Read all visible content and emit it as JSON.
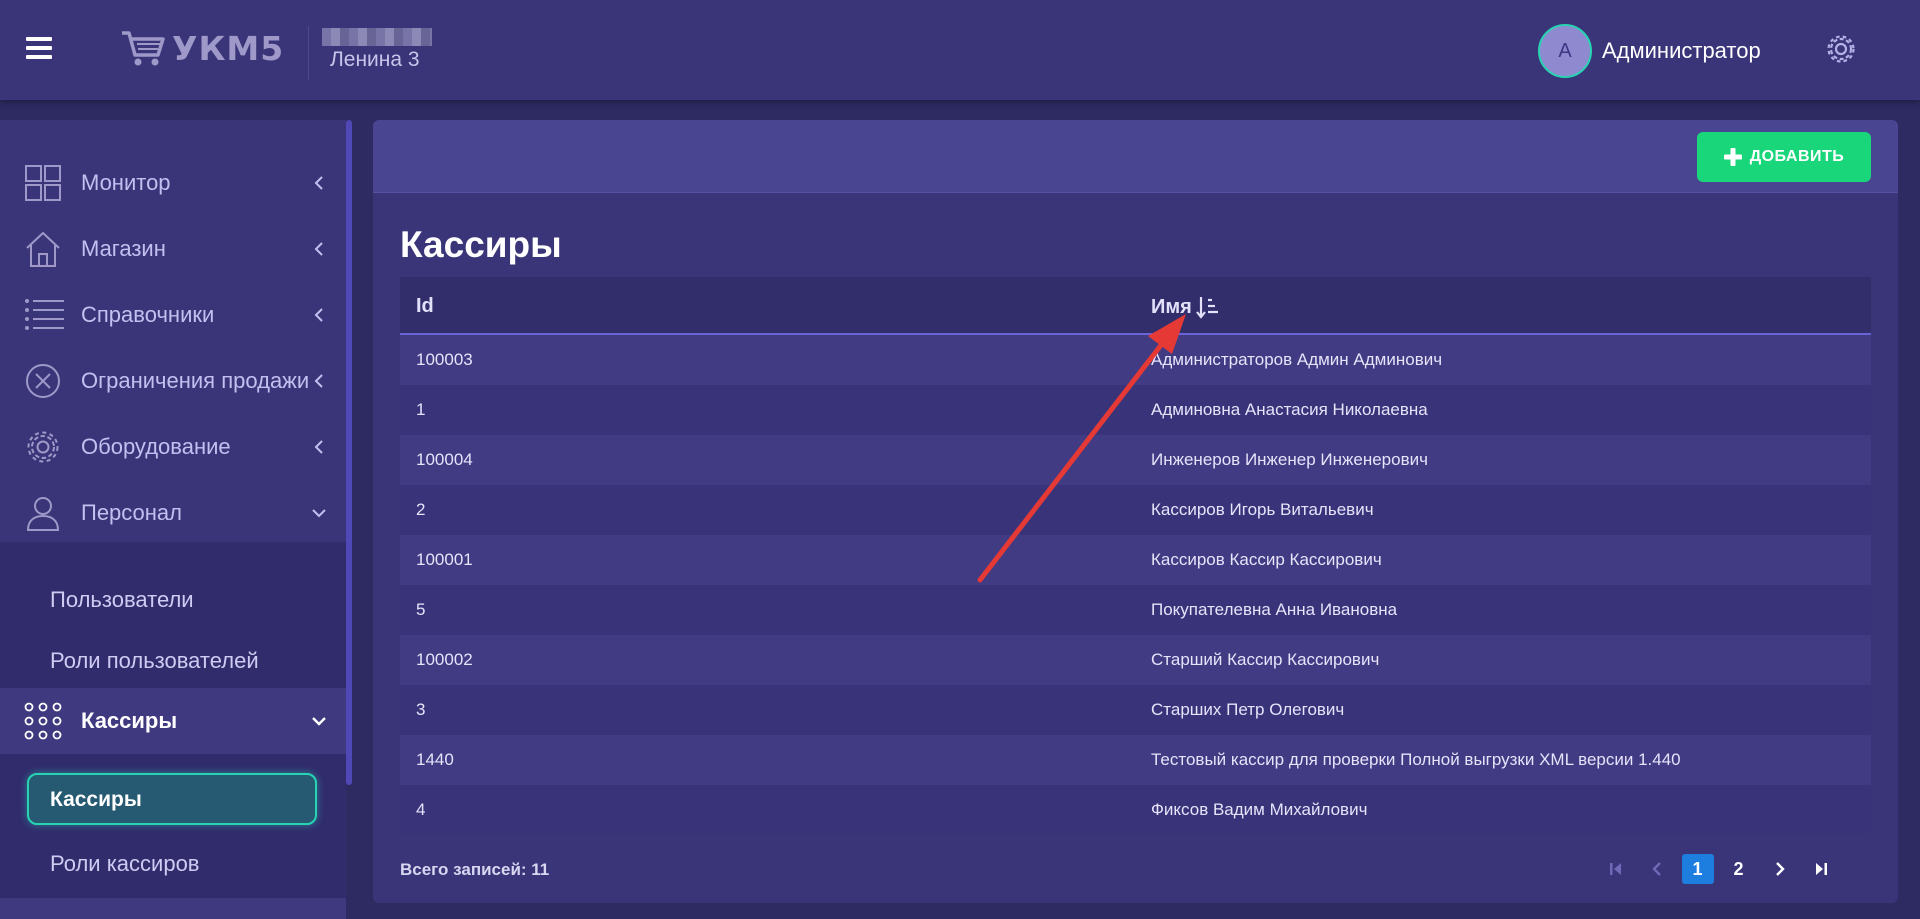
{
  "header": {
    "logo_text": "УКМ5",
    "store_name": "Ленина 3",
    "user_initial": "А",
    "user_name": "Администратор"
  },
  "sidebar": {
    "items": [
      {
        "label": "Монитор",
        "icon": "grid-icon"
      },
      {
        "label": "Магазин",
        "icon": "home-icon"
      },
      {
        "label": "Справочники",
        "icon": "list-icon"
      },
      {
        "label": "Ограничения продажи",
        "icon": "close-circle-icon"
      },
      {
        "label": "Оборудование",
        "icon": "gear-icon"
      },
      {
        "label": "Персонал",
        "icon": "person-icon"
      }
    ],
    "personnel_sub": [
      "Пользователи",
      "Роли пользователей"
    ],
    "cashiers_section": "Кассиры",
    "cashiers_sub": [
      "Кассиры",
      "Роли кассиров"
    ],
    "active_sub": "Кассиры"
  },
  "toolbar": {
    "add_label": "ДОБАВИТЬ"
  },
  "page": {
    "title": "Кассиры"
  },
  "table": {
    "columns": [
      "Id",
      "Имя"
    ],
    "rows": [
      {
        "id": "100003",
        "name": "Администраторов Админ Админович"
      },
      {
        "id": "1",
        "name": "Админовна Анастасия Николаевна"
      },
      {
        "id": "100004",
        "name": "Инженеров Инженер Инженерович"
      },
      {
        "id": "2",
        "name": "Кассиров Игорь Витальевич"
      },
      {
        "id": "100001",
        "name": "Кассиров Кассир Кассирович"
      },
      {
        "id": "5",
        "name": "Покупателевна Анна Ивановна"
      },
      {
        "id": "100002",
        "name": "Старший Кассир Кассирович"
      },
      {
        "id": "3",
        "name": "Старших Петр Олегович"
      },
      {
        "id": "1440",
        "name": "Тестовый кассир для проверки Полной выгрузки XML версии 1.440"
      },
      {
        "id": "4",
        "name": "Фиксов Вадим Михайлович"
      }
    ]
  },
  "footer": {
    "total_label": "Всего записей: 11",
    "pages": [
      "1",
      "2"
    ],
    "current_page": "1"
  },
  "colors": {
    "accent_green": "#19d67a",
    "active_border": "#27d3b2",
    "page_active": "#1e7ee0",
    "annotation_arrow": "#e53935"
  }
}
